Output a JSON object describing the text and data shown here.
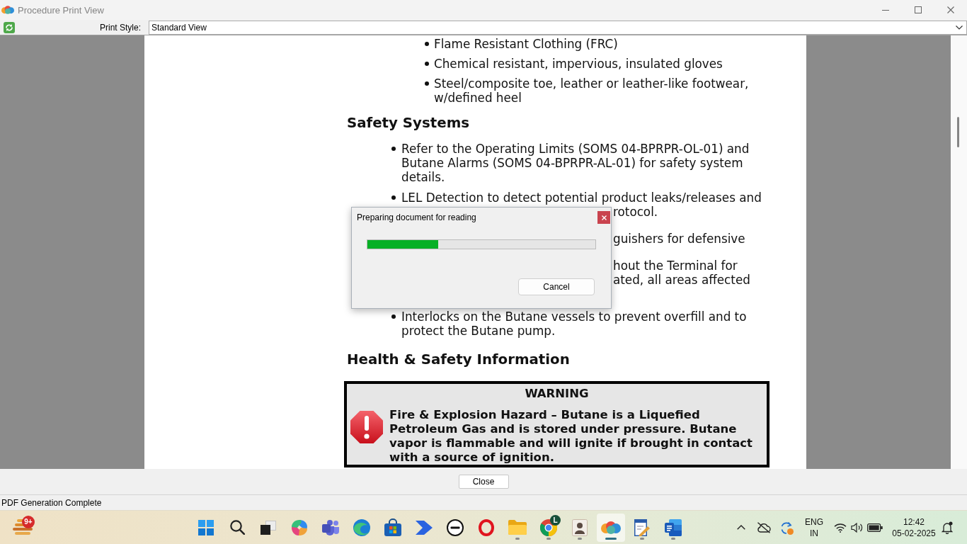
{
  "window": {
    "title": "Procedure Print View"
  },
  "toolbar": {
    "print_style": {
      "label": "Print Style:",
      "value": "Standard View"
    }
  },
  "document": {
    "ppe_items": [
      "Flame Resistant Clothing (FRC)",
      "Chemical resistant, impervious, insulated gloves",
      "Steel/composite toe, leather or leather-like footwear, w/defined heel"
    ],
    "safety_systems": {
      "heading": "Safety Systems",
      "items": [
        {
          "kind": "bullet",
          "text": "Refer to the Operating Limits (SOMS 04-BPRPR-OL-01) and Butane Alarms (SOMS 04-BPRPR-AL-01) for safety system details."
        },
        {
          "kind": "bullet",
          "text": "LEL Detection to detect potential product leaks/releases and"
        },
        {
          "kind": "covered_line",
          "text": "rotocol."
        },
        {
          "kind": "covered_item",
          "text": "guishers for defensive"
        },
        {
          "kind": "covered_item",
          "text": "hout the Terminal for"
        },
        {
          "kind": "covered_line",
          "text": "ated, all areas affected"
        },
        {
          "kind": "bullet",
          "text": "Interlocks on the Butane vessels to prevent overfill and to protect the Butane pump."
        }
      ]
    },
    "health_safety": {
      "heading": "Health & Safety Information",
      "warning": {
        "title": "WARNING",
        "text": "Fire & Explosion Hazard – Butane is a Liquefied Petroleum Gas and is stored under pressure. Butane vapor is flammable and will ignite if brought in contact with a source of ignition."
      }
    }
  },
  "dialog": {
    "title": "Preparing document for reading",
    "progress": {
      "level": 0.31
    },
    "buttons": [
      "Cancel"
    ]
  },
  "footer": {
    "buttons": [
      "Close"
    ]
  },
  "status_bar": {
    "text": "PDF Generation Complete"
  },
  "taskbar": {
    "widget": {
      "badge": "9+"
    },
    "apps": [
      {
        "kind": "start",
        "selected": false,
        "running": false
      },
      {
        "kind": "search",
        "selected": false,
        "running": false
      },
      {
        "kind": "taskview",
        "selected": false,
        "running": false
      },
      {
        "kind": "swirl",
        "selected": false,
        "running": false
      },
      {
        "kind": "people",
        "selected": false,
        "running": false
      },
      {
        "kind": "wave",
        "selected": false,
        "running": false
      },
      {
        "kind": "bag",
        "selected": false,
        "running": false
      },
      {
        "kind": "arrow",
        "selected": false,
        "running": false
      },
      {
        "kind": "circle_logo",
        "selected": false,
        "running": false
      },
      {
        "kind": "ring",
        "selected": false,
        "running": false
      },
      {
        "kind": "folder",
        "selected": false,
        "running": true
      },
      {
        "kind": "ball",
        "selected": false,
        "running": true,
        "badge": "L"
      },
      {
        "kind": "portrait",
        "selected": false,
        "running": true
      },
      {
        "kind": "blobs",
        "selected": true,
        "running": true
      },
      {
        "kind": "pen_doc",
        "selected": false,
        "running": true
      },
      {
        "kind": "doc_tile",
        "selected": false,
        "running": true
      }
    ],
    "tray": {
      "language": "ENG",
      "region": "IN",
      "time": "12:42",
      "date": "05-02-2025"
    }
  }
}
